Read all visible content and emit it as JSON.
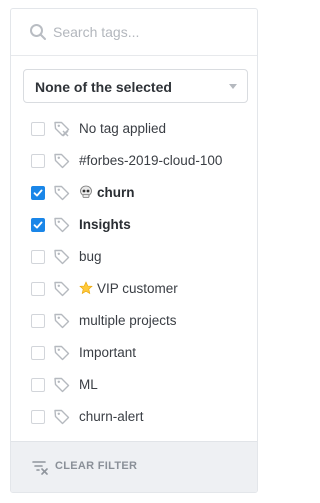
{
  "search": {
    "placeholder": "Search tags...",
    "icon": "search-icon"
  },
  "filter_mode": {
    "selected": "None of the selected"
  },
  "tags": [
    {
      "label": "No tag applied",
      "checked": false,
      "bold": false,
      "emoji": null,
      "icon": "tag-x-icon"
    },
    {
      "label": "#forbes-2019-cloud-100",
      "checked": false,
      "bold": false,
      "emoji": null,
      "icon": "tag-icon"
    },
    {
      "label": "churn",
      "checked": true,
      "bold": true,
      "emoji": "skull",
      "icon": "tag-icon"
    },
    {
      "label": "Insights",
      "checked": true,
      "bold": true,
      "emoji": null,
      "icon": "tag-icon"
    },
    {
      "label": "bug",
      "checked": false,
      "bold": false,
      "emoji": null,
      "icon": "tag-icon"
    },
    {
      "label": "VIP customer",
      "checked": false,
      "bold": false,
      "emoji": "star",
      "icon": "tag-icon"
    },
    {
      "label": "multiple projects",
      "checked": false,
      "bold": false,
      "emoji": null,
      "icon": "tag-icon"
    },
    {
      "label": "Important",
      "checked": false,
      "bold": false,
      "emoji": null,
      "icon": "tag-icon"
    },
    {
      "label": "ML",
      "checked": false,
      "bold": false,
      "emoji": null,
      "icon": "tag-icon"
    },
    {
      "label": "churn-alert",
      "checked": false,
      "bold": false,
      "emoji": null,
      "icon": "tag-icon"
    },
    {
      "label": "",
      "checked": false,
      "bold": false,
      "emoji": null,
      "icon": "tag-icon"
    }
  ],
  "footer": {
    "clear_label": "CLEAR FILTER"
  },
  "colors": {
    "accent": "#1a86e8",
    "footer_bg": "#eef0f3"
  }
}
